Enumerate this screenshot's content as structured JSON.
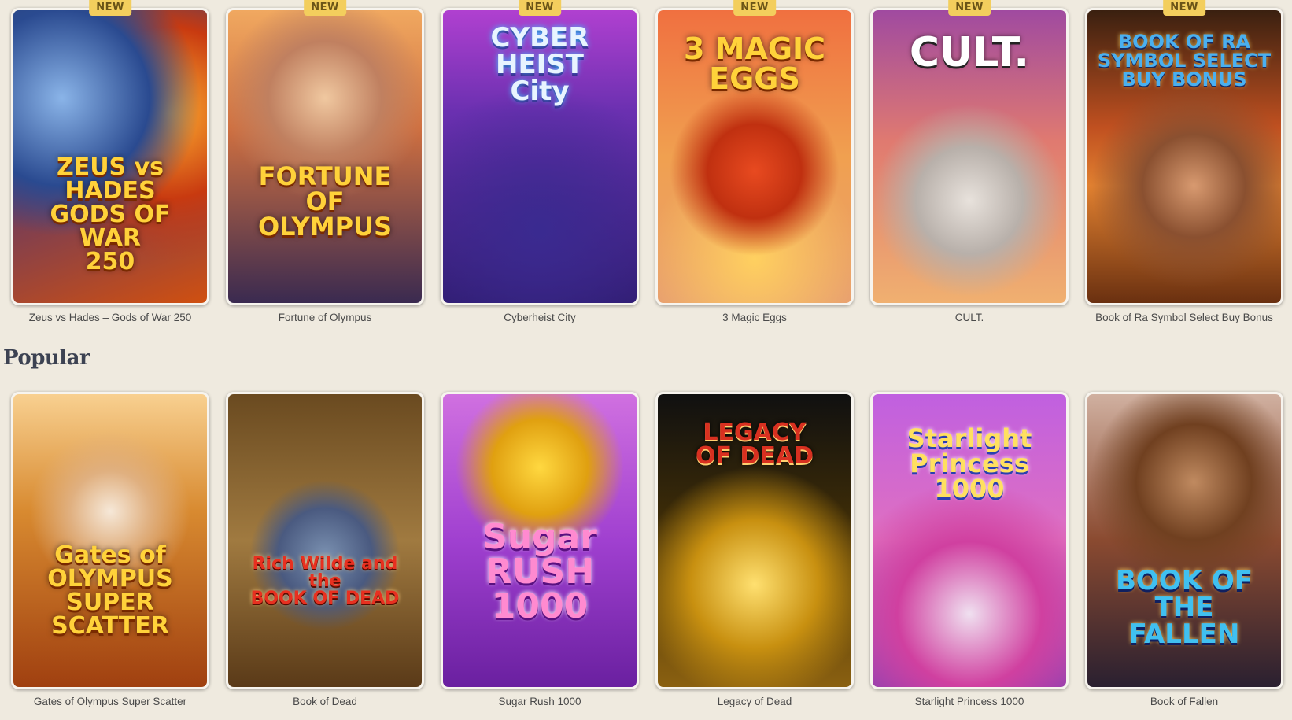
{
  "new_games": [
    {
      "badge": "NEW",
      "caption": "Zeus vs Hades – Gods of War 250",
      "art_title": "ZEUS vs HADES\nGODS OF WAR\n250"
    },
    {
      "badge": "NEW",
      "caption": "Fortune of Olympus",
      "art_title": "FORTUNE\nOF\nOLYMPUS"
    },
    {
      "badge": "NEW",
      "caption": "Cyberheist City",
      "art_title": "CYBER\nHEIST\nCity"
    },
    {
      "badge": "NEW",
      "caption": "3 Magic Eggs",
      "art_title": "3 MAGIC\nEGGS"
    },
    {
      "badge": "NEW",
      "caption": "CULT.",
      "art_title": "CULT."
    },
    {
      "badge": "NEW",
      "caption": "Book of Ra Symbol Select Buy Bonus",
      "art_title": "BOOK OF RA\nSYMBOL SELECT\nBUY BONUS"
    }
  ],
  "popular_section": {
    "title": "Popular"
  },
  "popular_games": [
    {
      "caption": "Gates of Olympus Super Scatter",
      "art_title": "Gates of\nOLYMPUS\nSUPER SCATTER"
    },
    {
      "caption": "Book of Dead",
      "art_title": "Rich Wilde and the\nBOOK OF DEAD"
    },
    {
      "caption": "Sugar Rush 1000",
      "art_title": "Sugar\nRUSH\n1000"
    },
    {
      "caption": "Legacy of Dead",
      "art_title": "LEGACY\nOF DEAD"
    },
    {
      "caption": "Starlight Princess 1000",
      "art_title": "Starlight\nPrincess\n1000"
    },
    {
      "caption": "Book of Fallen",
      "art_title": "BOOK OF\nTHE FALLEN"
    }
  ]
}
